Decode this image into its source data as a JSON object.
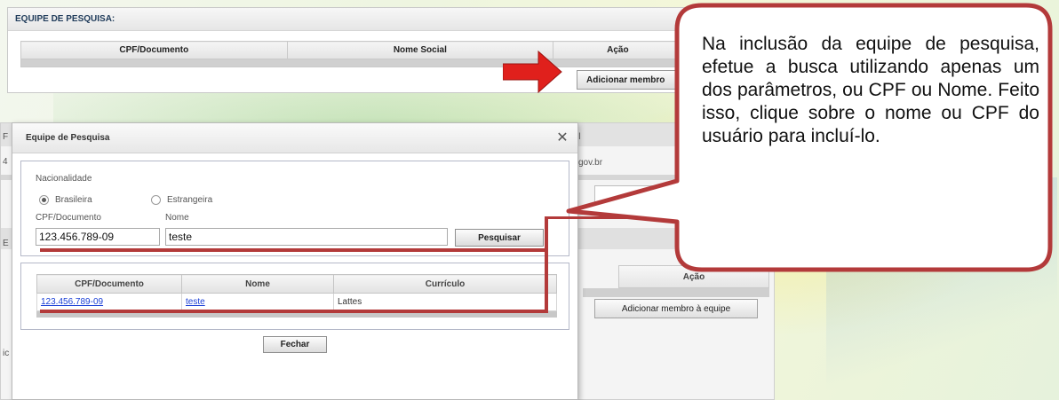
{
  "top_panel": {
    "section_title": "EQUIPE DE PESQUISA:",
    "columns": [
      "CPF/Documento",
      "Nome Social",
      "Ação"
    ],
    "add_button": "Adicionar membro"
  },
  "background_panel": {
    "email_fragment": "gov.br",
    "column_action": "Ação",
    "add_button": "Adicionar membro à equipe",
    "edge_chars": [
      "F",
      "4",
      "E",
      "ic"
    ],
    "header_fragment": "il"
  },
  "dialog": {
    "title": "Equipe de Pesquisa",
    "close_icon": "✕",
    "nacionalidade_label": "Nacionalidade",
    "radio_brasileira": "Brasileira",
    "radio_estrangeira": "Estrangeira",
    "cpf_label": "CPF/Documento",
    "cpf_value": "123.456.789-09",
    "nome_label": "Nome",
    "nome_value": "teste",
    "search_button": "Pesquisar",
    "results": {
      "columns": [
        "CPF/Documento",
        "Nome",
        "Currículo"
      ],
      "rows": [
        {
          "cpf": "123.456.789-09",
          "nome": "teste",
          "curriculo": "Lattes"
        }
      ]
    },
    "close_button": "Fechar"
  },
  "callout": {
    "text": "Na inclusão da equipe de pesquisa, efetue a busca utilizando apenas um dos parâmetros, ou CPF ou Nome. Feito isso, clique sobre o nome ou CPF do usuário para incluí-lo."
  },
  "colors": {
    "highlight": "#b33a3a",
    "arrow": "#e0201c",
    "link": "#1a3fd6"
  }
}
